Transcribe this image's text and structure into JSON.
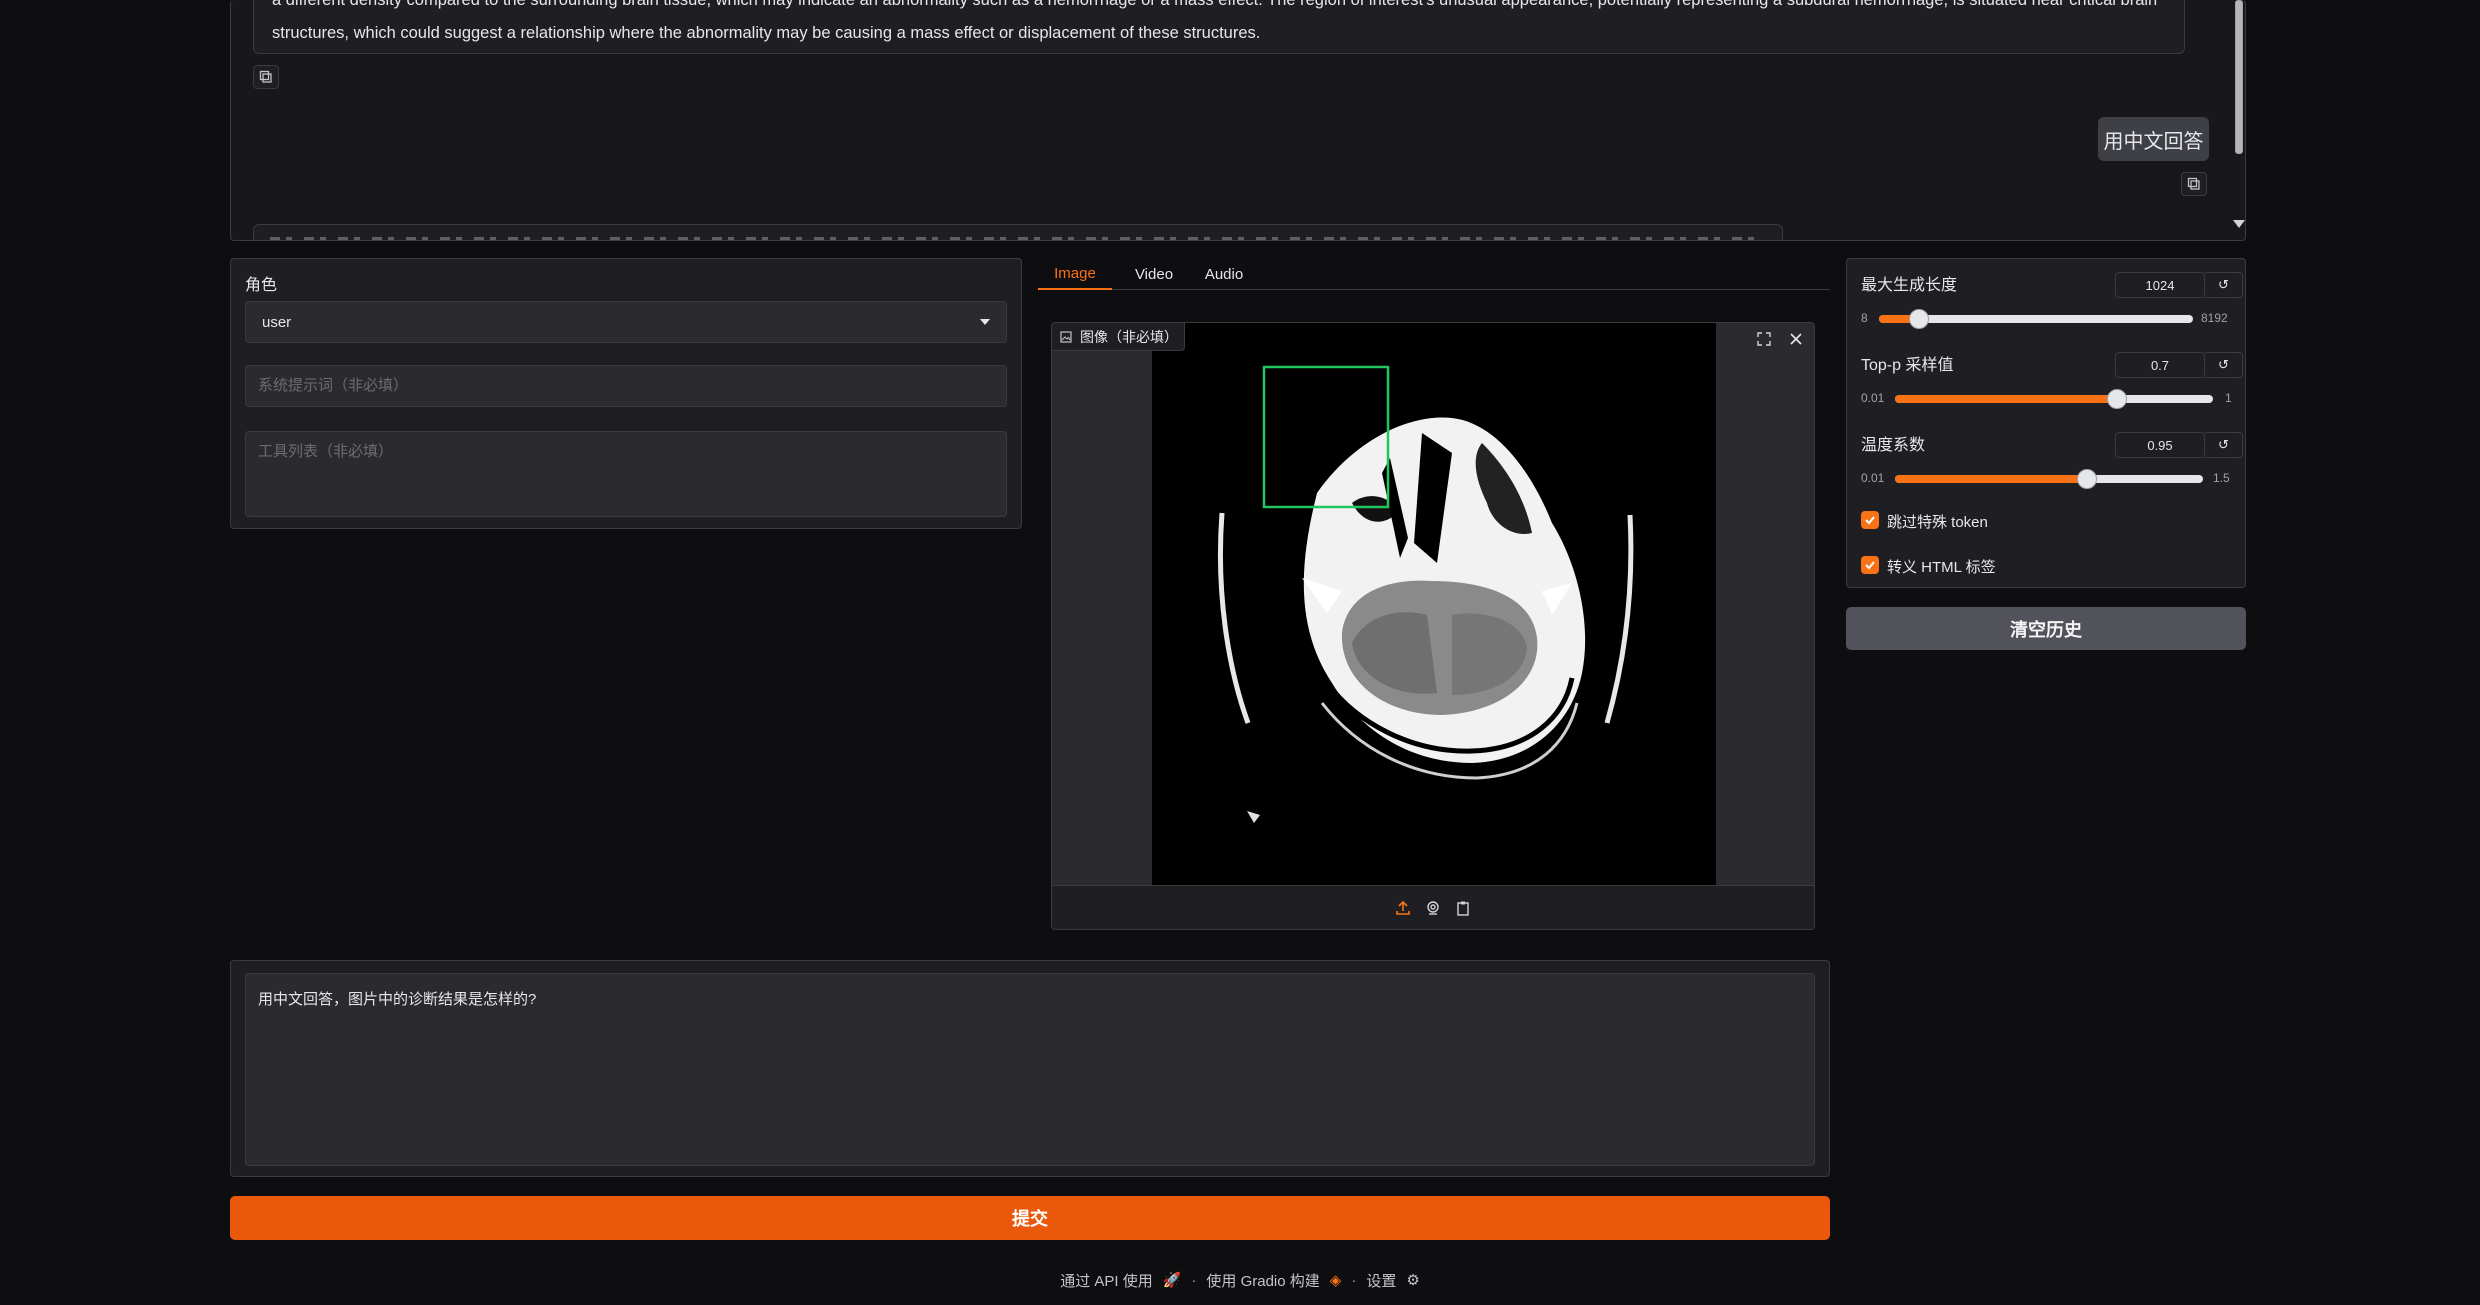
{
  "chat": {
    "bot_message_line1": "a different density compared to the surrounding brain tissue, which may indicate an abnormality such as a hemorrhage or a mass effect. The region of interest's unusual appearance, potentially representing a subdural hemorrhage, is situated near critical brain",
    "bot_message_line2": "structures, which could suggest a relationship where the abnormality may be causing a mass effect or displacement of these structures.",
    "user_message": "用中文回答"
  },
  "role": {
    "label": "角色",
    "value": "user"
  },
  "system_prompt": {
    "placeholder": "系统提示词（非必填）"
  },
  "tools": {
    "placeholder": "工具列表（非必填）"
  },
  "tabs": [
    {
      "label": "Image",
      "active": true
    },
    {
      "label": "Video",
      "active": false
    },
    {
      "label": "Audio",
      "active": false
    }
  ],
  "image": {
    "label": "图像（非必填）"
  },
  "params": {
    "max_len": {
      "label": "最大生成长度",
      "value": "1024",
      "min": "8",
      "max": "8192",
      "fraction": 0.127
    },
    "top_p": {
      "label": "Top-p 采样值",
      "value": "0.7",
      "min": "0.01",
      "max": "1",
      "fraction": 0.7
    },
    "temperature": {
      "label": "温度系数",
      "value": "0.95",
      "min": "0.01",
      "max": "1.5",
      "fraction": 0.63
    }
  },
  "checkboxes": [
    {
      "label": "跳过特殊 token",
      "checked": true
    },
    {
      "label": "转义 HTML 标签",
      "checked": true
    }
  ],
  "clear_button": "清空历史",
  "query": {
    "value": "用中文回答，图片中的诊断结果是怎样的?"
  },
  "submit_button": "提交",
  "footer": {
    "api": "通过 API 使用",
    "gradio": "使用 Gradio 构建",
    "settings": "设置"
  },
  "colors": {
    "accent": "#ea580c",
    "bbox": "#22c55e"
  }
}
